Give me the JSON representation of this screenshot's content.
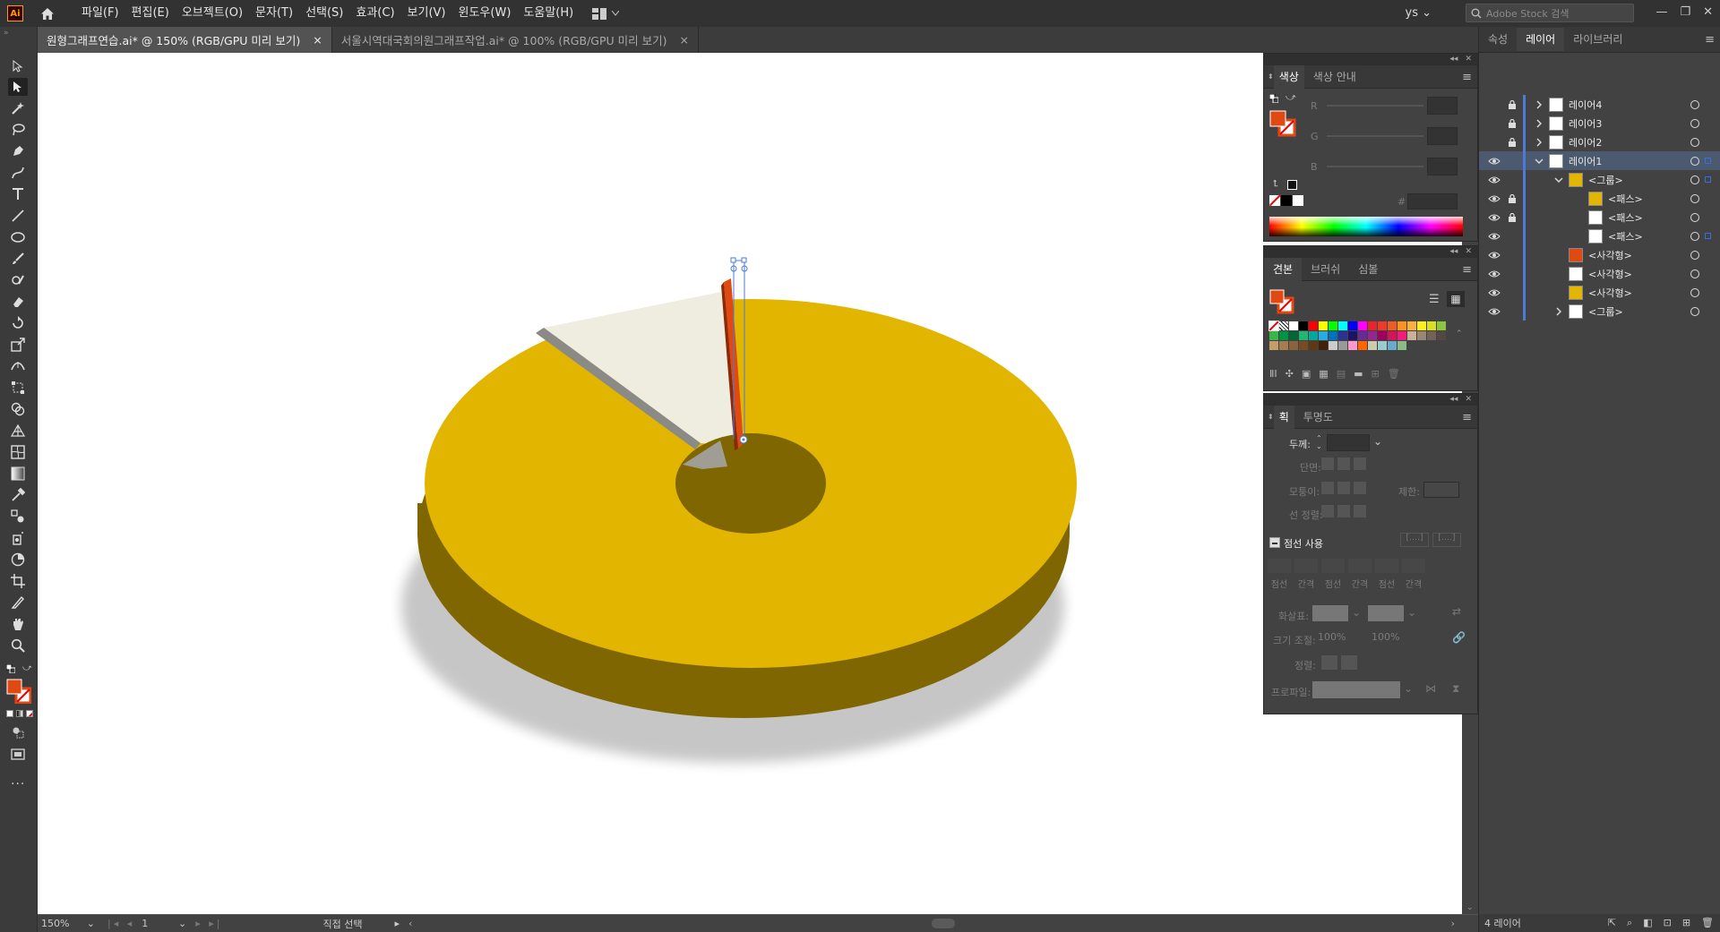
{
  "app": {
    "logo": "Ai",
    "user": "ys",
    "search_placeholder": "Adobe Stock 검색"
  },
  "menu": {
    "items": [
      "파일(F)",
      "편집(E)",
      "오브젝트(O)",
      "문자(T)",
      "선택(S)",
      "효과(C)",
      "보기(V)",
      "윈도우(W)",
      "도움말(H)"
    ]
  },
  "tabs": [
    {
      "label": "원형그래프연습.ai* @ 150% (RGB/GPU 미리 보기)",
      "close": "×"
    },
    {
      "label": "서울시역대국회의원그래프작업.ai* @ 100% (RGB/GPU 미리 보기)",
      "close": "×"
    }
  ],
  "colors": {
    "accent_orange": "#e04a12",
    "yellow": "#e2b600",
    "cream": "#efece0",
    "dark_yellow": "#7f6600",
    "panel": "#424242",
    "selection_blue": "#4a7bd6"
  },
  "status": {
    "zoom": "150%",
    "artboard": "1",
    "tool_name": "직접 선택"
  },
  "color_panel": {
    "tabs": [
      "색상",
      "색상 안내"
    ],
    "channels": [
      "R",
      "G",
      "B"
    ],
    "hex_label": "#"
  },
  "swatch_panel": {
    "tabs": [
      "견본",
      "브러쉬",
      "심볼"
    ]
  },
  "stroke_panel": {
    "tabs": [
      "획",
      "투명도"
    ],
    "weight_label": "두께:",
    "cap_label": "단면:",
    "corner_label": "모퉁이:",
    "limit_label": "제한:",
    "align_label": "선 정렬:",
    "dashed_label": "점선 사용",
    "dash_labels": [
      "점선",
      "간격",
      "점선",
      "간격",
      "점선",
      "간격"
    ],
    "arrow_label": "화살표:",
    "scale_label": "크기 조절:",
    "scale_values": [
      "100%",
      "100%"
    ],
    "align2_label": "정렬:",
    "profile_label": "프로파일:"
  },
  "right_panel": {
    "tabs": [
      "속성",
      "레이어",
      "라이브러리"
    ],
    "layers": [
      {
        "name": "레이어4",
        "locked": true,
        "indent": 0,
        "arrow": "right",
        "highlight": false,
        "thumb": "#ffffff"
      },
      {
        "name": "레이어3",
        "locked": true,
        "indent": 0,
        "arrow": "right",
        "highlight": false,
        "thumb": "#ffffff"
      },
      {
        "name": "레이어2",
        "locked": true,
        "indent": 0,
        "arrow": "right",
        "highlight": false,
        "thumb": "#ffffff"
      },
      {
        "name": "레이어1",
        "locked": false,
        "indent": 0,
        "arrow": "down",
        "highlight": true,
        "thumb": "#ffffff"
      },
      {
        "name": "<그룹>",
        "locked": false,
        "indent": 1,
        "arrow": "down",
        "highlight": false,
        "thumb": "#e2b600"
      },
      {
        "name": "<패스>",
        "locked": true,
        "indent": 2,
        "arrow": "",
        "highlight": false,
        "thumb": "#e2b600"
      },
      {
        "name": "<패스>",
        "locked": true,
        "indent": 2,
        "arrow": "",
        "highlight": false,
        "thumb": "#ffffff"
      },
      {
        "name": "<패스>",
        "locked": false,
        "indent": 2,
        "arrow": "",
        "highlight": false,
        "thumb": "#ffffff"
      },
      {
        "name": "<사각형>",
        "locked": false,
        "indent": 1,
        "arrow": "",
        "highlight": false,
        "thumb": "#e04a12"
      },
      {
        "name": "<사각형>",
        "locked": false,
        "indent": 1,
        "arrow": "",
        "highlight": false,
        "thumb": "#ffffff"
      },
      {
        "name": "<사각형>",
        "locked": false,
        "indent": 1,
        "arrow": "",
        "highlight": false,
        "thumb": "#e2b600"
      },
      {
        "name": "<그룹>",
        "locked": false,
        "indent": 1,
        "arrow": "right",
        "highlight": false,
        "thumb": "#ffffff"
      }
    ],
    "footer": "4 레이어"
  }
}
